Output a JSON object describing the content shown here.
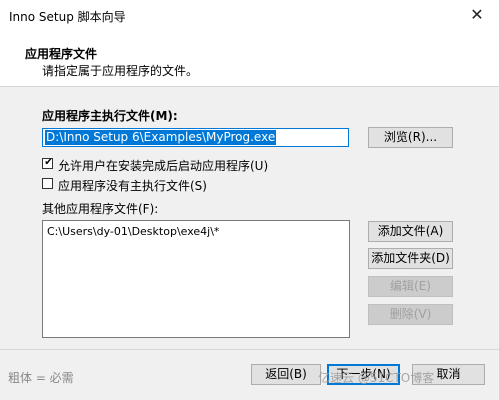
{
  "window": {
    "title": "Inno Setup 脚本向导",
    "close_glyph": "✕"
  },
  "header": {
    "title": "应用程序文件",
    "subtitle": "请指定属于应用程序的文件。"
  },
  "main_exe": {
    "label": "应用程序主执行文件(M):",
    "value": "D:\\Inno Setup 6\\Examples\\MyProg.exe",
    "browse_label": "浏览(R)..."
  },
  "options": {
    "allow_launch": {
      "label": "允许用户在安装完成后启动应用程序(U)",
      "checked": true
    },
    "no_main_exe": {
      "label": "应用程序没有主执行文件(S)",
      "checked": false
    }
  },
  "other_files": {
    "label": "其他应用程序文件(F):",
    "items": [
      "C:\\Users\\dy-01\\Desktop\\exe4j\\*"
    ],
    "add_file": "添加文件(A)",
    "add_folder": "添加文件夹(D)",
    "edit": "编辑(E)",
    "delete": "删除(V)"
  },
  "footer": {
    "note": "粗体 = 必需",
    "back": "返回(B)",
    "next": "下一步(N)",
    "cancel": "取消",
    "watermark": "亿速云 @51CTO博客"
  },
  "colors": {
    "accent": "#0078d7",
    "button_bg": "#e1e1e1",
    "disabled_text": "#a0a0a0"
  }
}
